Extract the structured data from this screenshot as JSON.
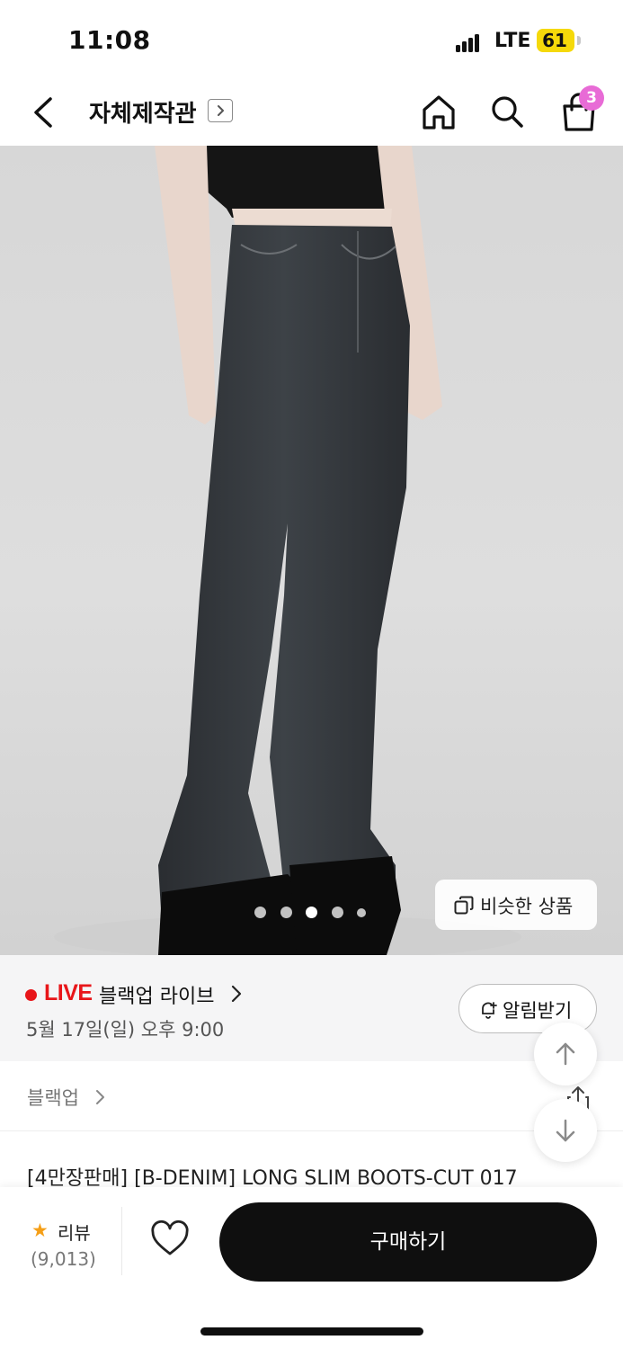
{
  "status_bar": {
    "time": "11:08",
    "network": "LTE",
    "battery": "61"
  },
  "header": {
    "title": "자체제작관",
    "icons": [
      "back-icon",
      "chevron-right-box-icon",
      "home-icon",
      "search-icon",
      "shopping-bag-icon"
    ],
    "cart_count": "3"
  },
  "gallery": {
    "dots_total": 5,
    "dots_active_index": 2,
    "similar_button_label": "비슷한 상품",
    "similar_icon": "copy-icon"
  },
  "live": {
    "badge": "LIVE",
    "title": "블랙업 라이브",
    "datetime": "5월 17일(일) 오후 9:00",
    "notify_label": "알림받기",
    "notify_icon": "bell-plus-icon",
    "accent_color": "#e8161a"
  },
  "brand": {
    "name": "블랙업",
    "share_icon": "share-icon"
  },
  "product": {
    "title": "[4만장판매] [B-DENIM] LONG SLIM BOOTS-CUT 017"
  },
  "bottom_bar": {
    "review_label": "리뷰",
    "review_count": "(9,013)",
    "like_icon": "heart-icon",
    "buy_label": "구매하기"
  },
  "floating": {
    "scroll_up_icon": "arrow-up-icon",
    "scroll_down_icon": "arrow-down-icon"
  }
}
